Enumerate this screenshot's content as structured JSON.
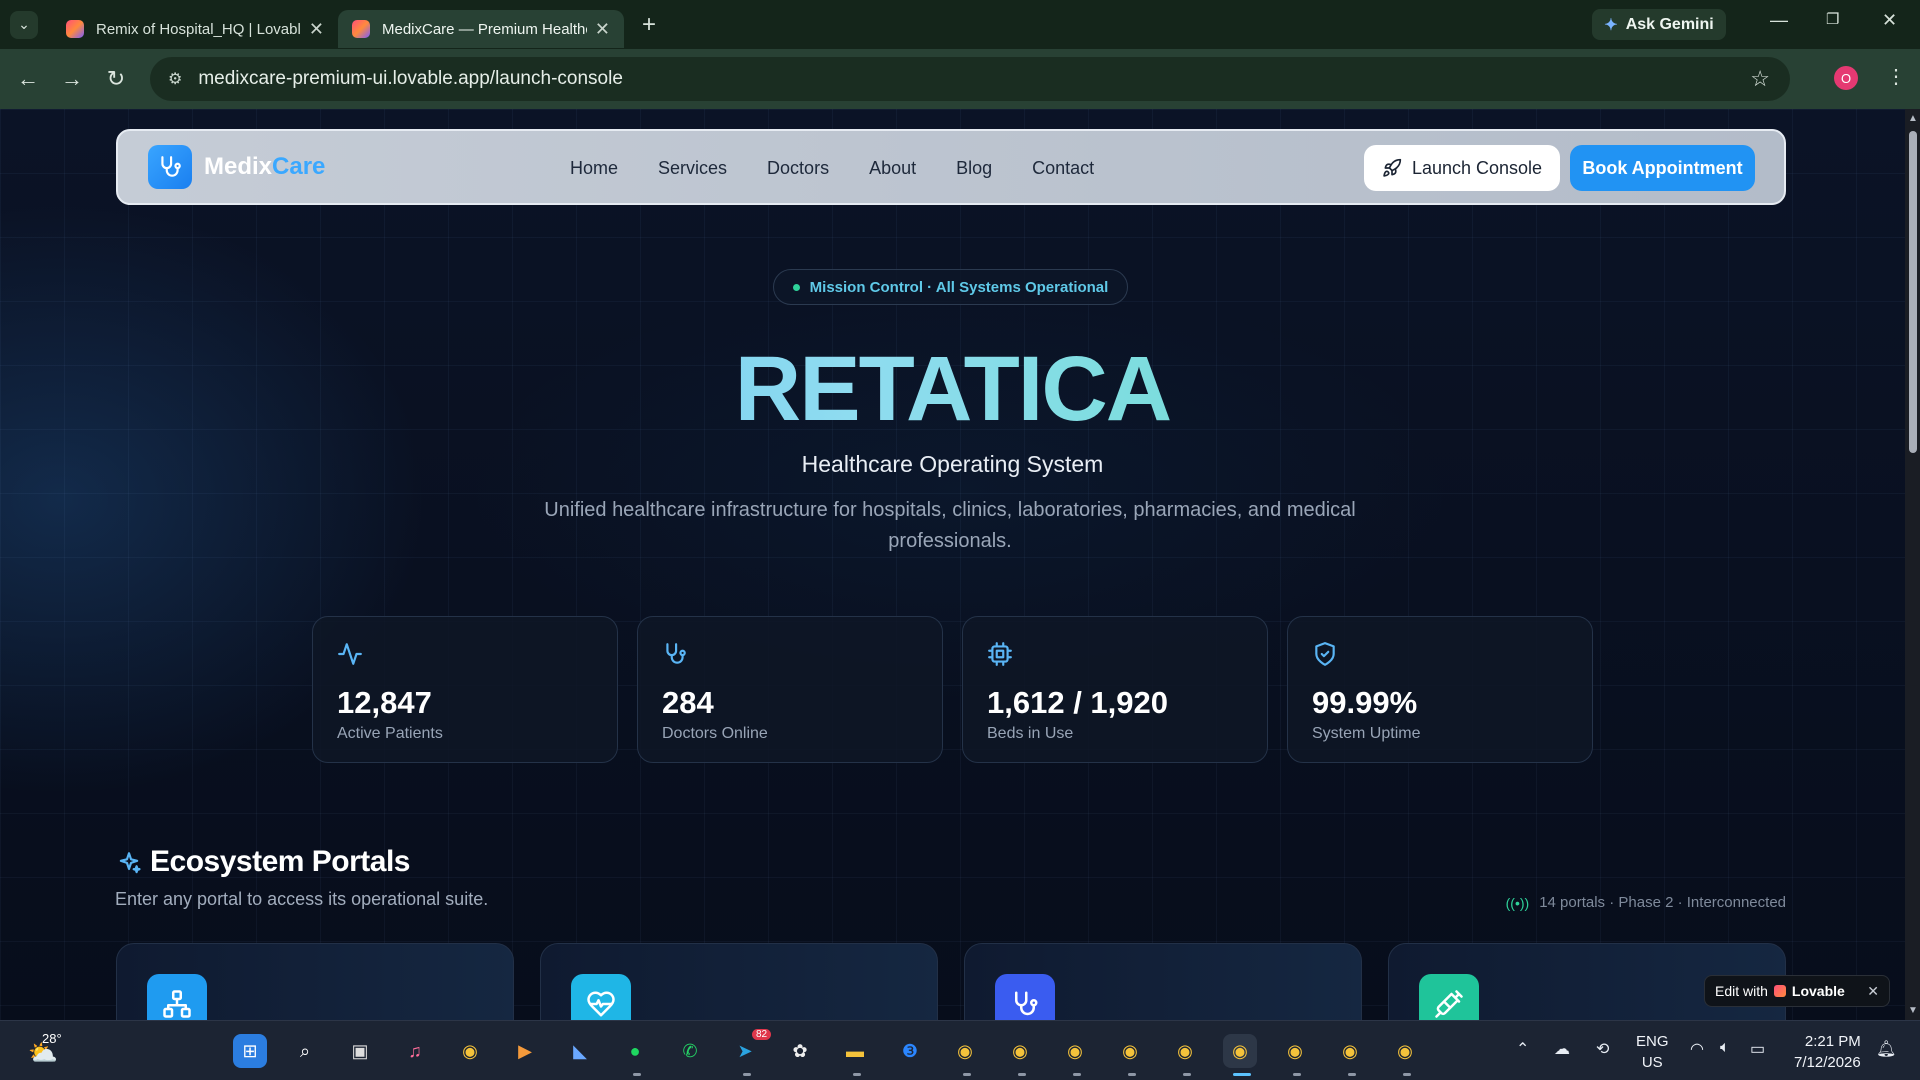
{
  "browser": {
    "tabs": [
      {
        "title": "Remix of Hospital_HQ | Lovable"
      },
      {
        "title": "MedixCare — Premium Healthcare"
      }
    ],
    "ask_gemini": "Ask Gemini",
    "url": "medixcare-premium-ui.lovable.app/launch-console",
    "profile_initial": "O"
  },
  "site": {
    "brand_part1": "Medix",
    "brand_part2": "Care",
    "nav": [
      "Home",
      "Services",
      "Doctors",
      "About",
      "Blog",
      "Contact"
    ],
    "launch_console": "Launch Console",
    "book_appointment": "Book Appointment"
  },
  "hero": {
    "status_pill": "Mission Control · All Systems Operational",
    "title": "RETATICA",
    "subtitle": "Healthcare Operating System",
    "description": "Unified healthcare infrastructure for hospitals, clinics, laboratories, pharmacies, and medical professionals."
  },
  "stats": [
    {
      "icon": "activity-icon",
      "value": "12,847",
      "label": "Active Patients"
    },
    {
      "icon": "stethoscope-icon",
      "value": "284",
      "label": "Doctors Online"
    },
    {
      "icon": "cpu-icon",
      "value": "1,612 / 1,920",
      "label": "Beds in Use"
    },
    {
      "icon": "shield-check-icon",
      "value": "99.99%",
      "label": "System Uptime"
    }
  ],
  "ecosystem": {
    "title": "Ecosystem Portals",
    "subtitle": "Enter any portal to access its operational suite.",
    "meta": "14 portals · Phase 2 · Interconnected",
    "portals": [
      {
        "icon": "network-icon",
        "color": "#1f9bf0"
      },
      {
        "icon": "heart-pulse-icon",
        "color": "#1fb6e6"
      },
      {
        "icon": "stethoscope-icon",
        "color": "#3a5cf0"
      },
      {
        "icon": "syringe-icon",
        "color": "#1fc49a"
      }
    ]
  },
  "lovable_badge": {
    "prefix": "Edit with",
    "brand": "Lovable"
  },
  "taskbar": {
    "weather_temp": "28°",
    "telegram_badge": "82",
    "lang_line1": "ENG",
    "lang_line2": "US",
    "time": "2:21 PM",
    "date": "7/12/2026"
  },
  "colors": {
    "accent_blue": "#2193f3",
    "status_green": "#2fd29a",
    "title_gradient_start": "#4fb8f5",
    "title_gradient_end": "#4fe0b0"
  }
}
